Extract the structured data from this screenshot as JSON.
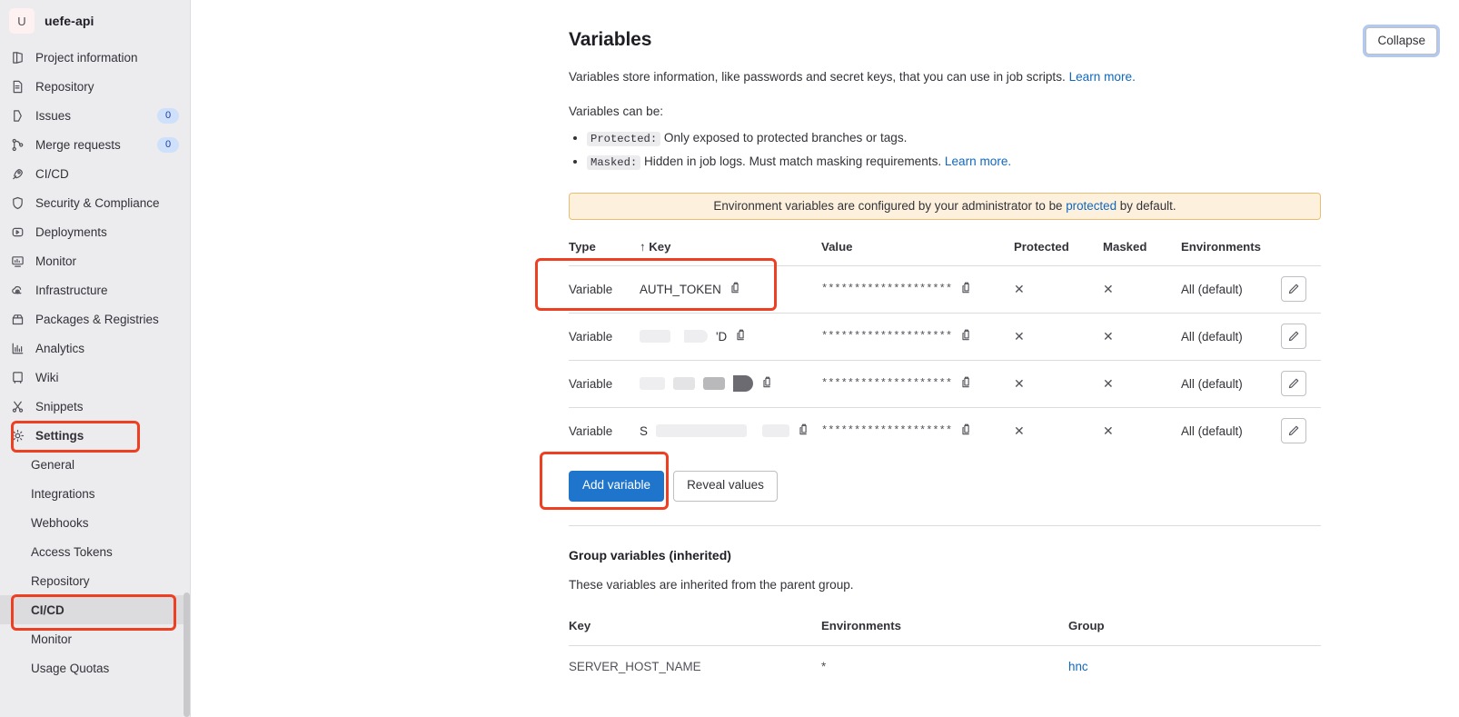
{
  "sidebar": {
    "project": {
      "avatar_initial": "U",
      "name": "uefe-api"
    },
    "items": [
      {
        "label": "Project information",
        "icon": "book-icon",
        "badge": null,
        "bold": false
      },
      {
        "label": "Repository",
        "icon": "document-icon",
        "badge": null,
        "bold": false
      },
      {
        "label": "Issues",
        "icon": "issue-icon",
        "badge": "0",
        "bold": false
      },
      {
        "label": "Merge requests",
        "icon": "merge-icon",
        "badge": "0",
        "bold": false
      },
      {
        "label": "CI/CD",
        "icon": "rocket-icon",
        "badge": null,
        "bold": false
      },
      {
        "label": "Security & Compliance",
        "icon": "shield-icon",
        "badge": null,
        "bold": false
      },
      {
        "label": "Deployments",
        "icon": "deployments-icon",
        "badge": null,
        "bold": false
      },
      {
        "label": "Monitor",
        "icon": "monitor-icon",
        "badge": null,
        "bold": false
      },
      {
        "label": "Infrastructure",
        "icon": "cloud-gear-icon",
        "badge": null,
        "bold": false
      },
      {
        "label": "Packages & Registries",
        "icon": "package-icon",
        "badge": null,
        "bold": false
      },
      {
        "label": "Analytics",
        "icon": "chart-icon",
        "badge": null,
        "bold": false
      },
      {
        "label": "Wiki",
        "icon": "wiki-icon",
        "badge": null,
        "bold": false
      },
      {
        "label": "Snippets",
        "icon": "snippet-icon",
        "badge": null,
        "bold": false
      },
      {
        "label": "Settings",
        "icon": "gear-icon",
        "badge": null,
        "bold": true
      }
    ],
    "settings_subitems": [
      {
        "label": "General",
        "active": false
      },
      {
        "label": "Integrations",
        "active": false
      },
      {
        "label": "Webhooks",
        "active": false
      },
      {
        "label": "Access Tokens",
        "active": false
      },
      {
        "label": "Repository",
        "active": false
      },
      {
        "label": "CI/CD",
        "active": true
      },
      {
        "label": "Monitor",
        "active": false
      },
      {
        "label": "Usage Quotas",
        "active": false
      }
    ]
  },
  "header": {
    "collapse_label": "Collapse",
    "title": "Variables"
  },
  "intro": {
    "lede": "Variables store information, like passwords and secret keys, that you can use in job scripts.",
    "lede_link": "Learn more.",
    "can_be": "Variables can be:",
    "bullets": [
      {
        "tag": "Protected:",
        "text": "Only exposed to protected branches or tags.",
        "link": null
      },
      {
        "tag": "Masked:",
        "text": "Hidden in job logs. Must match masking requirements.",
        "link": "Learn more."
      }
    ]
  },
  "alert": {
    "prefix": "Environment variables are configured by your administrator to be",
    "link": "protected",
    "suffix": "by default."
  },
  "table": {
    "headers": {
      "type": "Type",
      "key": "Key",
      "key_sort_arrow": "↑",
      "value": "Value",
      "protected": "Protected",
      "masked": "Masked",
      "environments": "Environments"
    },
    "rows": [
      {
        "type": "Variable",
        "key": "AUTH_TOKEN",
        "key_redacted": false,
        "redaction_style": "",
        "value": "********************",
        "protected": "✕",
        "masked": "✕",
        "environments": "All (default)"
      },
      {
        "type": "Variable",
        "key": "'D",
        "key_redacted": true,
        "redaction_style": "pair",
        "value": "********************",
        "protected": "✕",
        "masked": "✕",
        "environments": "All (default)"
      },
      {
        "type": "Variable",
        "key": "",
        "key_redacted": true,
        "redaction_style": "grad",
        "value": "********************",
        "protected": "✕",
        "masked": "✕",
        "environments": "All (default)"
      },
      {
        "type": "Variable",
        "key": "S",
        "key_redacted": true,
        "redaction_style": "wide",
        "value": "********************",
        "protected": "✕",
        "masked": "✕",
        "environments": "All (default)"
      }
    ],
    "copy_icon": "copy-to-clipboard-icon",
    "edit_icon": "pencil-icon"
  },
  "actions": {
    "add_variable": "Add variable",
    "reveal_values": "Reveal values"
  },
  "group_section": {
    "title": "Group variables (inherited)",
    "description": "These variables are inherited from the parent group.",
    "headers": {
      "key": "Key",
      "environments": "Environments",
      "group": "Group"
    },
    "rows": [
      {
        "key": "SERVER_HOST_NAME",
        "environments": "*",
        "group": "hnc"
      }
    ]
  },
  "colors": {
    "accent_blue": "#1f75cb",
    "link_blue": "#1068bf",
    "highlight_red": "#ef3f22",
    "alert_bg": "#fdf1dd",
    "alert_border": "#e9be74",
    "sidebar_bg": "#ececef",
    "badge_bg": "#cfe0fb"
  }
}
